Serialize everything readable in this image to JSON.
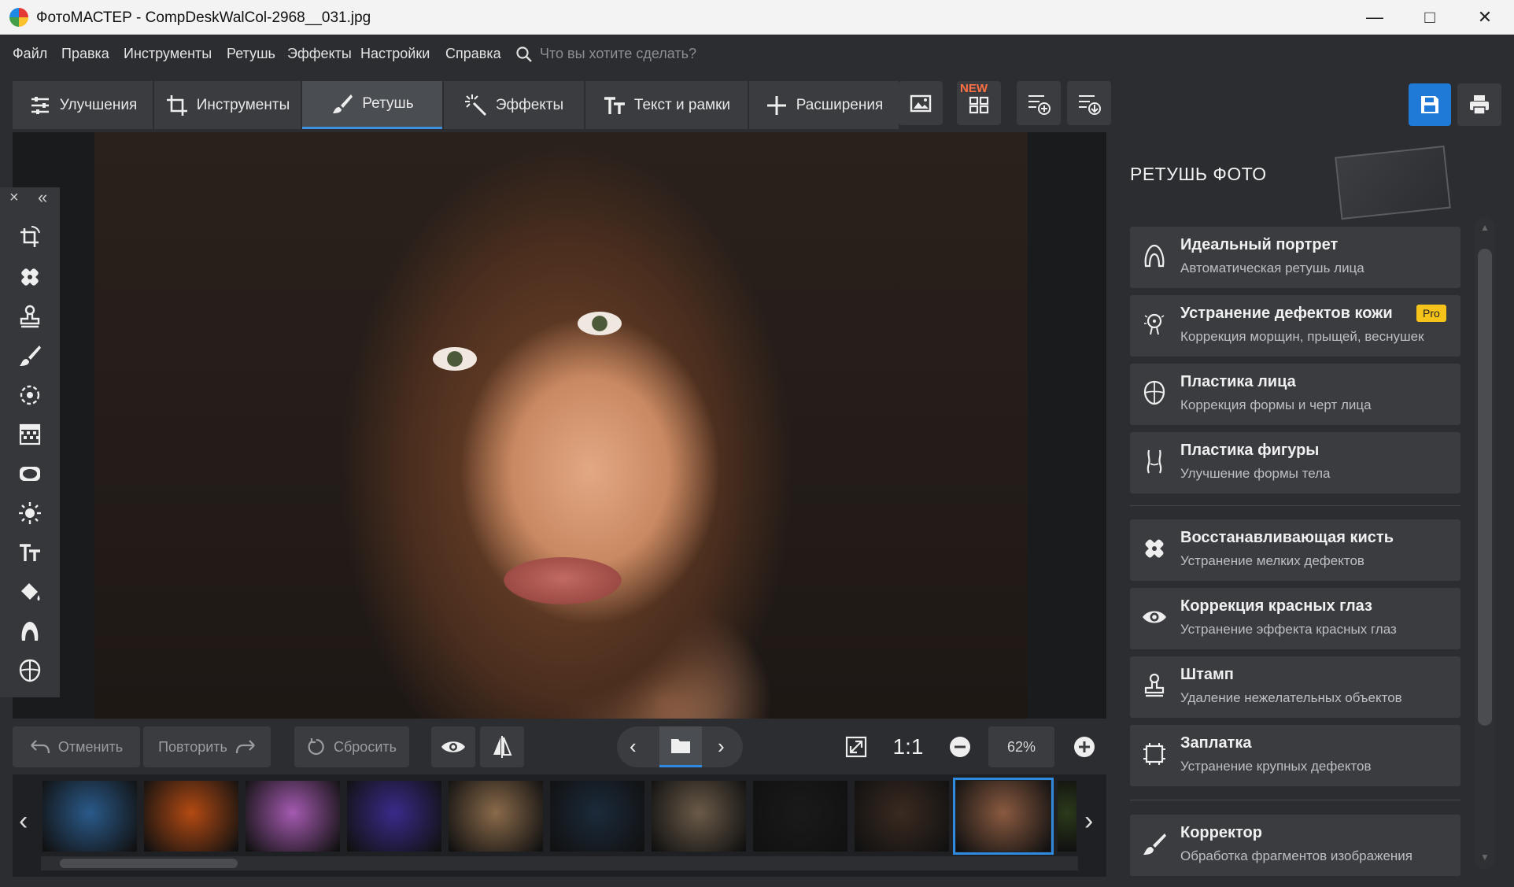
{
  "window": {
    "title": "ФотоМАСТЕР - CompDeskWalCol-2968__031.jpg"
  },
  "menu": {
    "items": [
      "Файл",
      "Правка",
      "Инструменты",
      "Ретушь",
      "Эффекты",
      "Настройки",
      "Справка"
    ],
    "search_placeholder": "Что вы хотите сделать?"
  },
  "tabs": [
    {
      "label": "Улучшения",
      "active": false
    },
    {
      "label": "Инструменты",
      "active": false
    },
    {
      "label": "Ретушь",
      "active": true
    },
    {
      "label": "Эффекты",
      "active": false
    },
    {
      "label": "Текст и рамки",
      "active": false
    },
    {
      "label": "Расширения",
      "active": false
    }
  ],
  "new_badge": "NEW",
  "actions": {
    "undo": "Отменить",
    "redo": "Повторить",
    "reset": "Сбросить"
  },
  "zoom": {
    "ratio": "1:1",
    "value": "62%"
  },
  "right_panel": {
    "title": "РЕТУШЬ ФОТО",
    "pro_label": "Pro",
    "cards": [
      {
        "title": "Идеальный портрет",
        "subtitle": "Автоматическая ретушь лица",
        "icon": "portrait-icon",
        "pro": false
      },
      {
        "title": "Устранение дефектов кожи",
        "subtitle": "Коррекция морщин, прыщей, веснушек",
        "icon": "skin-icon",
        "pro": true
      },
      {
        "title": "Пластика лица",
        "subtitle": "Коррекция формы и черт лица",
        "icon": "face-shape-icon",
        "pro": false
      },
      {
        "title": "Пластика фигуры",
        "subtitle": "Улучшение формы тела",
        "icon": "body-shape-icon",
        "pro": false
      },
      {
        "title": "Восстанавливающая кисть",
        "subtitle": "Устранение мелких дефектов",
        "icon": "healing-brush-icon",
        "pro": false
      },
      {
        "title": "Коррекция красных глаз",
        "subtitle": "Устранение эффекта красных глаз",
        "icon": "eye-icon",
        "pro": false
      },
      {
        "title": "Штамп",
        "subtitle": "Удаление нежелательных объектов",
        "icon": "stamp-icon",
        "pro": false
      },
      {
        "title": "Заплатка",
        "subtitle": "Устранение крупных дефектов",
        "icon": "patch-icon",
        "pro": false
      },
      {
        "title": "Корректор",
        "subtitle": "Обработка фрагментов изображения",
        "icon": "corrector-brush-icon",
        "pro": false
      }
    ]
  },
  "filmstrip": {
    "selected_index": 9,
    "thumbnails": [
      {
        "icon": "monster-thumbnail",
        "color": "#2a5a8a"
      },
      {
        "icon": "planet-thumbnail",
        "color": "#b34a12"
      },
      {
        "icon": "woman-purple-thumbnail",
        "color": "#a45ab0"
      },
      {
        "icon": "car-neon-thumbnail",
        "color": "#3a2a8a"
      },
      {
        "icon": "jars-thumbnail",
        "color": "#8a6a4a"
      },
      {
        "icon": "space-thumbnail",
        "color": "#1b2a3a"
      },
      {
        "icon": "woman-room-thumbnail",
        "color": "#6a5a48"
      },
      {
        "icon": "dog-thumbnail",
        "color": "#1a1a1a"
      },
      {
        "icon": "earth-flare-thumbnail",
        "color": "#3a2a20"
      },
      {
        "icon": "portrait-thumbnail",
        "color": "#8a5a40"
      },
      {
        "icon": "partial-thumbnail",
        "color": "#2a3a1a"
      }
    ]
  },
  "colors": {
    "accent": "#1e7ad6",
    "pro_badge": "#f6c31b",
    "new_badge": "#ff7043"
  }
}
